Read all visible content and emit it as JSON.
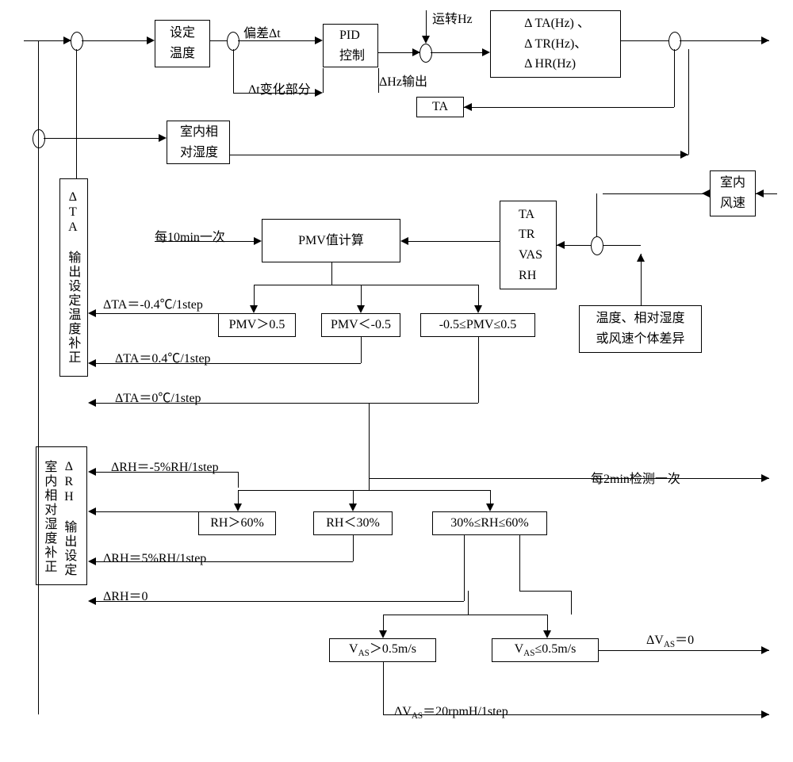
{
  "blocks": {
    "setTemp": "设定\n温度",
    "pid": "PID\n控制",
    "hzBox": "Δ TA(Hz) 、\nΔ TR(Hz)、\nΔ HR(Hz)",
    "ta": "TA",
    "indoorRH": "室内相\n对湿度",
    "indoorWind": "室内\n风速",
    "pmvCalc": "PMV值计算",
    "vars": "TA\nTR\nVAS\nRH",
    "diffNote": "温度、相对湿度\n或风速个体差异",
    "pmvHigh": "PMV＞0.5",
    "pmvLow": "PMV＜-0.5",
    "pmvMid": "-0.5≤PMV≤0.5",
    "rhHigh": "RH＞60%",
    "rhLow": "RH＜30%",
    "rhMid": "30%≤RH≤60%",
    "vasHigh": "V_AS＞0.5m/s",
    "vasLow": "V_AS≤0.5m/s"
  },
  "labels": {
    "devDt": "偏差Δt",
    "dtChange": "Δt变化部分",
    "runHz": "运转Hz",
    "dHzOut": "ΔHz输出",
    "every10": "每10min一次",
    "dTAneg": "ΔTA＝-0.4℃/1step",
    "dTApos": "ΔTA＝0.4℃/1step",
    "dTAzero": "ΔTA＝0℃/1step",
    "dRHneg": "ΔRH＝-5%RH/1step",
    "dRHpos": "ΔRH＝5%RH/1step",
    "dRHzero": "ΔRH＝0",
    "dVas20": "ΔV_AS＝20rpmH/1step",
    "dVasZero": "ΔV_AS＝0",
    "every2": "每2min检测一次"
  },
  "vlabels": {
    "taCorr": "ΔTA 输出设定温度补正",
    "rhCorr1": "ΔRH 输出设定",
    "rhCorr2": "室内相对湿度补正"
  }
}
